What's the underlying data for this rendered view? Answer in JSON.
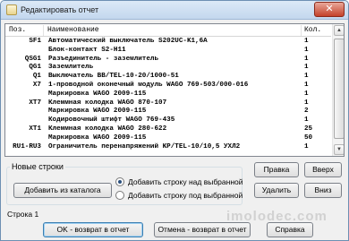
{
  "window": {
    "title": "Редактировать отчет",
    "close_glyph": "✕"
  },
  "report": {
    "columns": {
      "position": "Поз.",
      "name": "Наименование",
      "quantity": "Кол."
    },
    "rows": [
      {
        "position": "SF1",
        "name": "Автоматический выключатель S202UC-K1,6A",
        "quantity": "1"
      },
      {
        "position": "",
        "name": "Блок-контакт S2-H11",
        "quantity": "1"
      },
      {
        "position": "QSG1",
        "name": "Разъединитель - заземлитель",
        "quantity": "1"
      },
      {
        "position": "QG1",
        "name": "Заземлитель",
        "quantity": "1"
      },
      {
        "position": "Q1",
        "name": "Выключатель BB/TEL-10-20/1000-51",
        "quantity": "1"
      },
      {
        "position": "X7",
        "name": "1-проводной оконечный модуль WAGO 769-503/000-016",
        "quantity": "1"
      },
      {
        "position": "",
        "name": "Маркировка WAGO 2009-115",
        "quantity": "1"
      },
      {
        "position": "XT7",
        "name": "Клеммная колодка WAGO 870-107",
        "quantity": "1"
      },
      {
        "position": "",
        "name": "Маркировка WAGO 2009-115",
        "quantity": "2"
      },
      {
        "position": "",
        "name": "Кодировочный штифт WAGO 769-435",
        "quantity": "1"
      },
      {
        "position": "XT1",
        "name": "Клеммная колодка WAGO 280-622",
        "quantity": "25"
      },
      {
        "position": "",
        "name": "Маркировка WAGO 2009-115",
        "quantity": "50"
      },
      {
        "position": "RU1-RU3",
        "name": "Ограничитель перенапряжений KP/TEL-10/10,5 УХЛ2",
        "quantity": "1"
      }
    ]
  },
  "new_rows": {
    "group_label": "Новые строки",
    "add_from_catalog_label": "Добавить из каталога",
    "radio_above_label": "Добавить строку над выбранной",
    "radio_below_label": "Добавить строку под выбранной",
    "selected_option": "above"
  },
  "side_buttons": {
    "edit_label": "Правка",
    "up_label": "Вверх",
    "delete_label": "Удалить",
    "down_label": "Вниз"
  },
  "status": {
    "line_text": "Строка 1"
  },
  "footer": {
    "ok_label": "OK - возврат в отчет",
    "cancel_label": "Отмена - возврат в отчет",
    "help_label": "Справка"
  },
  "watermark": {
    "text": "imolodec.com"
  },
  "icons": {
    "app": "report-edit-icon",
    "close": "close-icon",
    "scroll_up": "scroll-up-arrow-icon",
    "scroll_down": "scroll-down-arrow-icon"
  },
  "colors": {
    "title_gradient_top": "#dce9f7",
    "close_button": "#c4412a",
    "default_button_border": "#3c7fb1"
  }
}
